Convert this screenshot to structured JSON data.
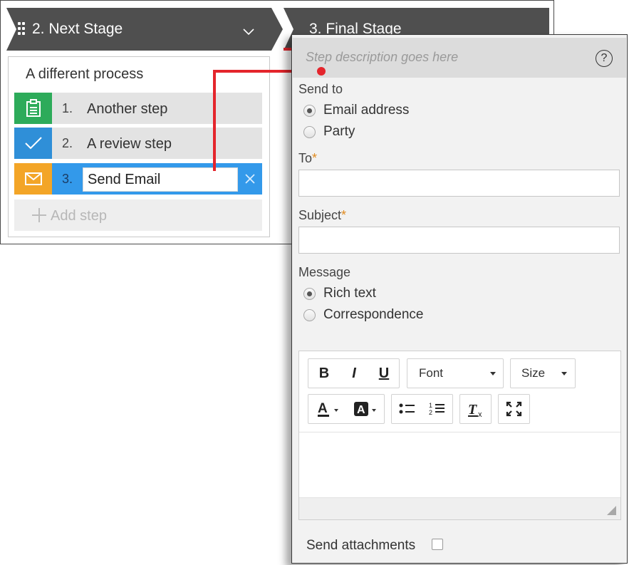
{
  "stages": {
    "current": {
      "label": "2.  Next Stage"
    },
    "next": {
      "label": "3.  Final Stage"
    }
  },
  "process": {
    "title": "A different process",
    "steps": [
      {
        "number": "1.",
        "label": "Another step",
        "icon": "clipboard-icon",
        "color": "#2dab5a"
      },
      {
        "number": "2.",
        "label": "A review step",
        "icon": "checkmark-icon",
        "color": "#2f8fd8"
      },
      {
        "number": "3.",
        "label": "Send Email",
        "icon": "envelope-icon",
        "color": "#f3a527"
      }
    ],
    "add_step_label": "Add step"
  },
  "properties": {
    "description_placeholder": "Step description goes here",
    "help_label": "?",
    "send_to": {
      "label": "Send to",
      "options": [
        "Email address",
        "Party"
      ],
      "selected": "Email address"
    },
    "to": {
      "label": "To",
      "required_mark": "*",
      "value": ""
    },
    "subject": {
      "label": "Subject",
      "required_mark": "*",
      "value": ""
    },
    "message": {
      "label": "Message",
      "options": [
        "Rich text",
        "Correspondence"
      ],
      "selected": "Rich text"
    },
    "editor": {
      "bold": "B",
      "italic": "I",
      "underline": "U",
      "font_label": "Font",
      "size_label": "Size"
    },
    "send_attachments_label": "Send attachments",
    "send_attachments_checked": false
  },
  "colors": {
    "connector": "#e4252c",
    "stage_bar": "#4f4f4f",
    "active_step": "#3399ea"
  }
}
